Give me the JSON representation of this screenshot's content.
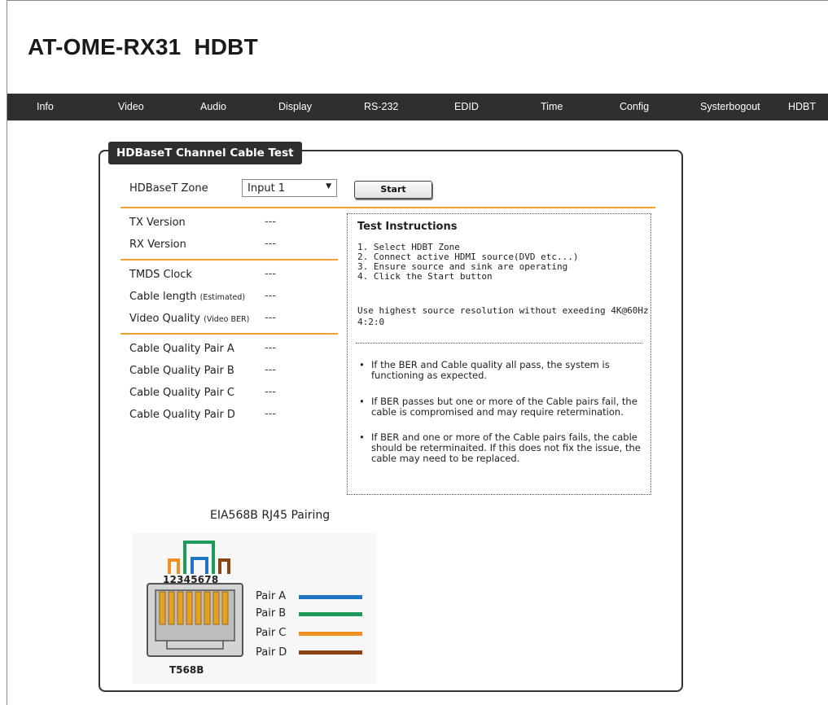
{
  "app": {
    "title": "AT-OME-RX31  HDBT"
  },
  "nav": {
    "items": [
      {
        "label": "Info"
      },
      {
        "label": "Video"
      },
      {
        "label": "Audio"
      },
      {
        "label": "Display"
      },
      {
        "label": "RS-232"
      },
      {
        "label": "EDID"
      },
      {
        "label": "Time"
      },
      {
        "label": "Config"
      },
      {
        "label": "Systerbogout"
      },
      {
        "label": "HDBT"
      }
    ]
  },
  "panel": {
    "title": "HDBaseT Channel Cable Test",
    "zone_label": "HDBaseT Zone",
    "zone_value": "Input 1",
    "start_label": "Start",
    "rows": [
      {
        "label": "TX Version",
        "sub": "",
        "value": "---"
      },
      {
        "label": "RX Version",
        "sub": "",
        "value": "---"
      },
      {
        "label": "TMDS Clock",
        "sub": "",
        "value": "---"
      },
      {
        "label": "Cable length",
        "sub": "(Estimated)",
        "value": "---"
      },
      {
        "label": "Video Quality",
        "sub": "(Video BER)",
        "value": "---"
      },
      {
        "label": "Cable Quality Pair A",
        "sub": "",
        "value": "---"
      },
      {
        "label": "Cable Quality Pair B",
        "sub": "",
        "value": "---"
      },
      {
        "label": "Cable Quality Pair C",
        "sub": "",
        "value": "---"
      },
      {
        "label": "Cable Quality Pair D",
        "sub": "",
        "value": "---"
      }
    ]
  },
  "instructions": {
    "title": "Test Instructions",
    "steps": [
      "1. Select HDBT Zone",
      "2. Connect active HDMI source(DVD etc...)",
      "3. Ensure source and sink are operating",
      "4. Click the Start button"
    ],
    "note_line1": "Use highest source resolution without exeeding 4K@60Hz",
    "note_line2": "4:2:0",
    "bullets": [
      "If the BER and Cable quality all pass, the system is functioning as expected.",
      "If BER passes but one or more of the Cable pairs fail, the cable is compromised and may require retermination.",
      "If BER and one or more of the Cable pairs fails, the cable should be reterminaited. If this does not fix the issue, the cable may need to be replaced."
    ]
  },
  "diagram": {
    "title": "EIA568B  RJ45 Pairing",
    "pins": "12345678",
    "standard": "T568B",
    "pairs": [
      {
        "label": "Pair A",
        "color": "#1f74c4"
      },
      {
        "label": "Pair B",
        "color": "#1e9a5a"
      },
      {
        "label": "Pair C",
        "color": "#f0901e"
      },
      {
        "label": "Pair D",
        "color": "#8b4513"
      }
    ]
  }
}
